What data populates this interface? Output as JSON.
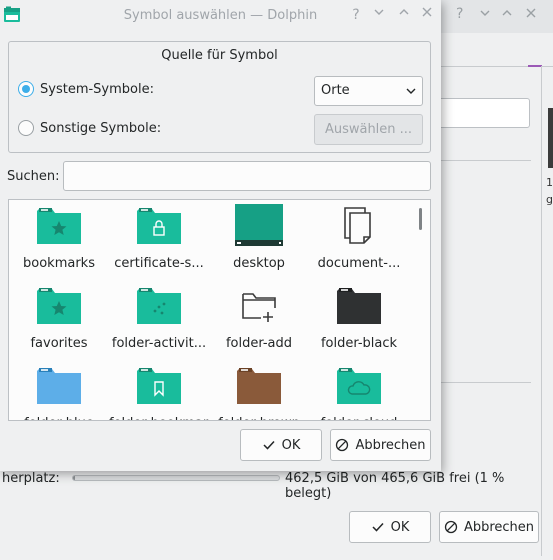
{
  "background_window": {
    "space_label": "herplatz:",
    "space_text": "462,5 GiB von 465,6 GiB frei (1 % belegt)",
    "space_used_fraction": 0.01,
    "ok_label": "OK",
    "cancel_label": "Abbrechen",
    "snippet_1": "1",
    "snippet_2": "g"
  },
  "dialog": {
    "title": "Symbol auswählen — Dolphin",
    "group_title": "Quelle für Symbol",
    "system_icons_label": "System-Symbole:",
    "other_icons_label": "Sonstige Symbole:",
    "combo_value": "Orte",
    "browse_label": "Auswählen ...",
    "search_label": "Suchen:",
    "search_value": "",
    "ok_label": "OK",
    "cancel_label": "Abbrechen"
  },
  "icons": [
    {
      "label": "bookmarks",
      "kind": "folder-star",
      "color": "#1abc9c"
    },
    {
      "label": "certificate-s...",
      "kind": "folder-lock",
      "color": "#1abc9c"
    },
    {
      "label": "desktop",
      "kind": "desktop",
      "color": "#16a085"
    },
    {
      "label": "document-...",
      "kind": "document",
      "color": "#3b3b3b"
    },
    {
      "label": "favorites",
      "kind": "folder-star",
      "color": "#1abc9c"
    },
    {
      "label": "folder-activit...",
      "kind": "folder-activity",
      "color": "#1abc9c"
    },
    {
      "label": "folder-add",
      "kind": "folder-add",
      "color": "#3b3b3b"
    },
    {
      "label": "folder-black",
      "kind": "folder-black",
      "color": "#2f3133"
    },
    {
      "label": "folder-blue",
      "kind": "folder-blue",
      "color": "#5daee8"
    },
    {
      "label": "folder-bookmark",
      "kind": "folder-bookmark",
      "color": "#1abc9c"
    },
    {
      "label": "folder-brown",
      "kind": "folder-brown",
      "color": "#8a5a3b"
    },
    {
      "label": "folder-cloud",
      "kind": "folder-cloud",
      "color": "#1abc9c"
    }
  ]
}
